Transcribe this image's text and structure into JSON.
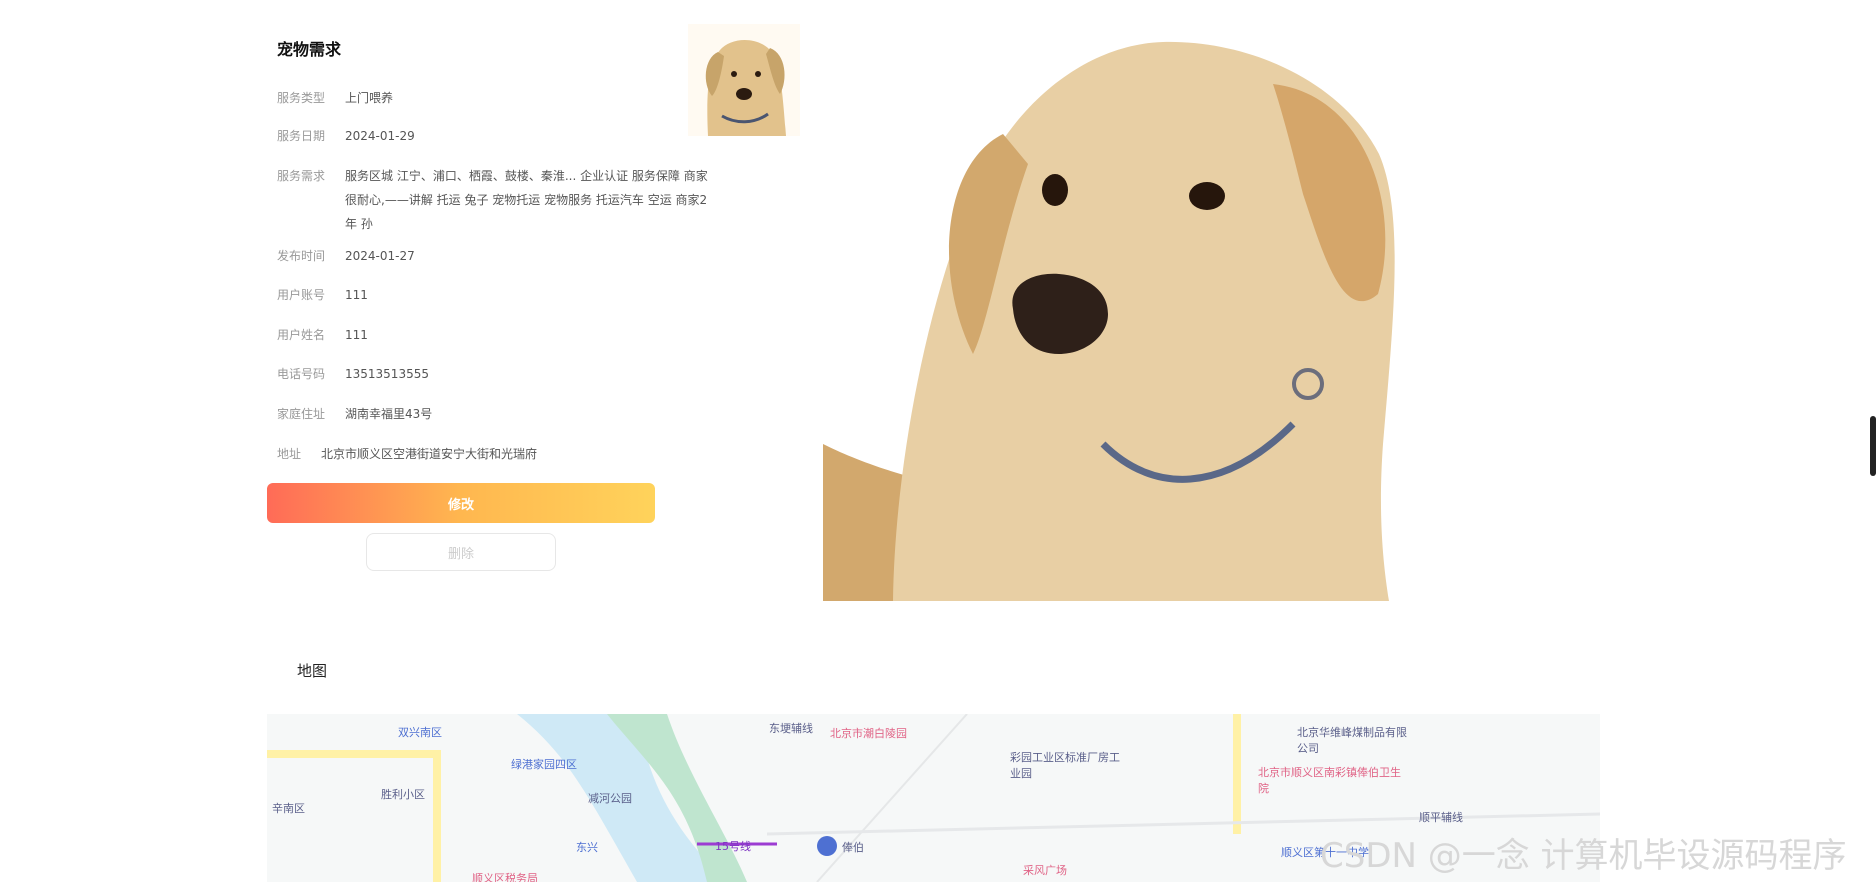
{
  "request": {
    "title": "宠物需求",
    "fields": [
      {
        "label": "服务类型",
        "value": "上门喂养"
      },
      {
        "label": "服务日期",
        "value": "2024-01-29"
      },
      {
        "label": "服务需求",
        "value": "服务区城 江宁、浦口、栖霞、鼓楼、秦淮... 企业认证 服务保障 商家很耐心,——讲解 托运 兔子 宠物托运 宠物服务 托运汽车 空运 商家2年 孙"
      },
      {
        "label": "发布时间",
        "value": "2024-01-27"
      },
      {
        "label": "用户账号",
        "value": "111"
      },
      {
        "label": "用户姓名",
        "value": "111"
      },
      {
        "label": "电话号码",
        "value": "13513513555"
      },
      {
        "label": "家庭住址",
        "value": "湖南幸福里43号"
      },
      {
        "label": "地址",
        "value": "北京市顺义区空港街道安宁大街和光瑞府"
      }
    ],
    "edit_button": "修改",
    "delete_button": "删除"
  },
  "map": {
    "section_title": "地图",
    "labels": [
      "双兴南区",
      "胜利小区",
      "辛南区",
      "绿港家园四区",
      "减河公园",
      "东兴",
      "北京市潮白陵园",
      "东埂辅线",
      "彩园工业区标准厂房工业园",
      "北京华维峰煤制品有限公司",
      "北京市顺义区南彩镇俸伯卫生院",
      "顺平辅线",
      "15号线",
      "俸伯",
      "采风广场",
      "顺义区第十一中学",
      "顺义区税务局"
    ]
  },
  "watermark": "CSDN @一念 计算机毕设源码程序",
  "colors": {
    "accent_start": "#ff6b57",
    "accent_end": "#ffd35b",
    "muted": "#999999",
    "pink_poi": "#e06386",
    "blue_poi": "#4e70d2"
  }
}
